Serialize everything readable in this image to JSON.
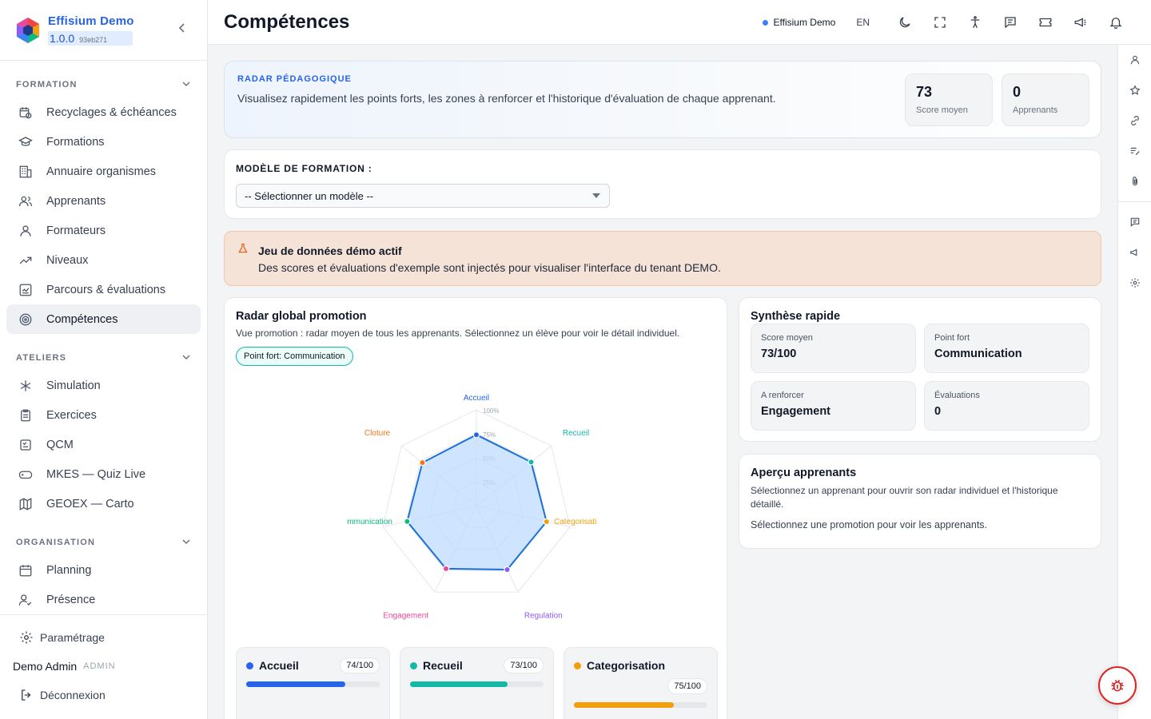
{
  "brand": {
    "name": "Effisium Demo",
    "version": "1.0.0",
    "hash": "93eb271"
  },
  "sidebar": {
    "sections": [
      {
        "title": "FORMATION",
        "items": [
          {
            "label": "Recyclages & échéances",
            "icon": "calendar-clock-icon"
          },
          {
            "label": "Formations",
            "icon": "graduation-cap-icon"
          },
          {
            "label": "Annuaire organismes",
            "icon": "building-icon"
          },
          {
            "label": "Apprenants",
            "icon": "users-icon"
          },
          {
            "label": "Formateurs",
            "icon": "user-icon"
          },
          {
            "label": "Niveaux",
            "icon": "trending-up-icon"
          },
          {
            "label": "Parcours & évaluations",
            "icon": "chart-board-icon"
          },
          {
            "label": "Compétences",
            "icon": "target-icon",
            "active": true
          }
        ]
      },
      {
        "title": "ATELIERS",
        "items": [
          {
            "label": "Simulation",
            "icon": "asterisk-icon"
          },
          {
            "label": "Exercices",
            "icon": "clipboard-icon"
          },
          {
            "label": "QCM",
            "icon": "checklist-icon"
          },
          {
            "label": "MKES — Quiz Live",
            "icon": "gamepad-icon"
          },
          {
            "label": "GEOEX — Carto",
            "icon": "map-icon"
          }
        ]
      },
      {
        "title": "ORGANISATION",
        "items": [
          {
            "label": "Planning",
            "icon": "calendar-icon"
          },
          {
            "label": "Présence",
            "icon": "user-check-icon"
          }
        ]
      }
    ],
    "settings_label": "Paramétrage",
    "user_name": "Demo Admin",
    "user_role": "ADMIN",
    "logout_label": "Déconnexion"
  },
  "topbar": {
    "title": "Compétences",
    "tenant": "Effisium Demo",
    "lang": "EN"
  },
  "hero": {
    "kicker": "RADAR PÉDAGOGIQUE",
    "description": "Visualisez rapidement les points forts, les zones à renforcer et l'historique d'évaluation de chaque apprenant.",
    "stats": [
      {
        "value": "73",
        "label": "Score moyen"
      },
      {
        "value": "0",
        "label": "Apprenants"
      }
    ]
  },
  "model": {
    "label": "MODÈLE DE FORMATION :",
    "selected": "-- Sélectionner un modèle --"
  },
  "demo_banner": {
    "title": "Jeu de données démo actif",
    "text": "Des scores et évaluations d'exemple sont injectés pour visualiser l'interface du tenant DEMO."
  },
  "radar_card": {
    "title": "Radar global promotion",
    "subtitle": "Vue promotion : radar moyen de tous les apprenants. Sélectionnez un élève pour voir le détail individuel.",
    "pill": "Point fort: Communication"
  },
  "chart_data": {
    "type": "radar",
    "axes": [
      "Accueil",
      "Recueil",
      "Categorisation",
      "Regulation",
      "Engagement",
      "Communication",
      "Cloture"
    ],
    "visible_axis_labels": [
      "Accueil",
      "Recueil",
      "Categorisati",
      "Regulation",
      "Engagement",
      "mmunication",
      "Cloture"
    ],
    "values": [
      74,
      73,
      75,
      74,
      73,
      74,
      72
    ],
    "range": [
      0,
      100
    ],
    "ticks": [
      "25%",
      "50%",
      "75%",
      "100%"
    ],
    "axis_colors": [
      "#2563eb",
      "#14b8a6",
      "#f59e0b",
      "#8b5cf6",
      "#ec4899",
      "#10b981",
      "#f97316"
    ],
    "fill_color": "#bfdbfe",
    "line_color": "#1d6fd8"
  },
  "mini_scores": [
    {
      "name": "Accueil",
      "score": "74/100",
      "value": 74,
      "color": "#2563eb"
    },
    {
      "name": "Recueil",
      "score": "73/100",
      "value": 73,
      "color": "#14b8a6"
    },
    {
      "name": "Categorisation",
      "score": "75/100",
      "value": 75,
      "color": "#f59e0b"
    }
  ],
  "synthese": {
    "title": "Synthèse rapide",
    "boxes": [
      {
        "label": "Score moyen",
        "value": "73/100"
      },
      {
        "label": "Point fort",
        "value": "Communication"
      },
      {
        "label": "A renforcer",
        "value": "Engagement"
      },
      {
        "label": "Évaluations",
        "value": "0"
      }
    ]
  },
  "apercu": {
    "title": "Aperçu apprenants",
    "p1": "Sélectionnez un apprenant pour ouvrir son radar individuel et l'historique détaillé.",
    "p2": "Sélectionnez une promotion pour voir les apprenants."
  }
}
